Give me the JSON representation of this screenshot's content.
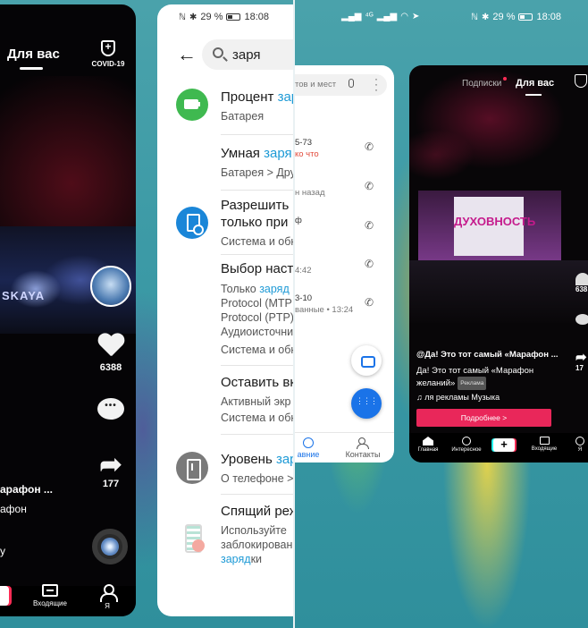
{
  "status_left": {
    "nfc": "ℕ",
    "bt": "✱",
    "battery": "29 %",
    "time": "18:08"
  },
  "status_right": {
    "net": "⁴ᴳ",
    "battery": "29 %",
    "time": "18:08"
  },
  "tiktok_left": {
    "tab": "Для вас",
    "covid": "COVID-19",
    "likes": "6388",
    "shares": "177",
    "title": "арафон ...",
    "subtitle": "афон",
    "extra": "у",
    "nav": {
      "inbox": "Входящие",
      "me": "Я"
    },
    "stage_text": "SKAYA"
  },
  "settings": {
    "query": "заря",
    "items": [
      {
        "title_pre": "Процент ",
        "title_hl": "зар",
        "line1": "Батарея",
        "icon_color": "#3fb950",
        "icon": "battery-icon"
      },
      {
        "title_pre": "Умная ",
        "title_hl": "заря",
        "line1": "Батарея > Дру",
        "icon": "none"
      },
      {
        "title_pre": "Разрешить ",
        "title_hl": "",
        "line2": "только при",
        "line1": "Система и обн",
        "icon_color": "#1a86d8",
        "icon": "usb-icon"
      },
      {
        "title_pre": "Выбор настр",
        "line1_pre": "Только ",
        "line1_hl": "заряд",
        "line2": "Protocol (MTP",
        "line3": "Protocol (PTP)",
        "line4": "Аудиоисточни",
        "line5": "Система и обн",
        "icon": "none"
      },
      {
        "title_pre": "Оставить вк",
        "line1": "Активный экр",
        "line2": "Система и обн",
        "icon": "none"
      },
      {
        "title_pre": "Уровень ",
        "title_hl": "зар",
        "line1": "О телефоне > О",
        "icon_color": "#7a7a7a",
        "icon": "phone-info-icon"
      },
      {
        "title_pre": "Спящий реж",
        "line1": "Используйте",
        "line2": "заблокирован",
        "line3_hl": "заряд",
        "line3_post": "ки",
        "icon": "sleep-icon"
      }
    ]
  },
  "phone_app": {
    "search_placeholder": "тов и мест",
    "entries": [
      {
        "text": "5-73",
        "style": "normal"
      },
      {
        "text": "ко что",
        "style": "red"
      },
      {
        "text": "н назад",
        "style": "grey"
      },
      {
        "text": "ф",
        "style": "normal"
      },
      {
        "text": "4:42",
        "style": "grey"
      },
      {
        "text": "3-10",
        "style": "normal"
      },
      {
        "text": "ванные • 13:24",
        "style": "grey"
      }
    ],
    "nav": {
      "recent": "авние",
      "contacts": "Контакты"
    }
  },
  "tiktok_right": {
    "tabs": {
      "following": "Подписки",
      "for_you": "Для вас"
    },
    "stage_word": "ДУХОВНОСТЬ",
    "likes": "638",
    "shares": "17",
    "title": "@Да! Это тот самый «Марафон ...",
    "desc1": "Да! Это тот самый «Марафон",
    "desc2": "желаний»",
    "ad_label": "Реклама",
    "music": "ля рекламы   Музыка",
    "button": "Подробнее >",
    "nav": {
      "home": "Главная",
      "discover": "Интересное",
      "plus": "+",
      "inbox": "Входящие",
      "me": "Я"
    }
  }
}
